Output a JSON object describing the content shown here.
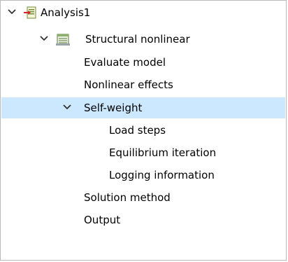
{
  "tree": {
    "analysis": {
      "label": "Analysis1",
      "icon": "analysis-document-icon",
      "expanded": true
    },
    "structural": {
      "label": "Structural nonlinear",
      "icon": "structural-nonlinear-icon",
      "expanded": true
    },
    "items": {
      "evaluate_model": "Evaluate model",
      "nonlinear_effects": "Nonlinear effects",
      "self_weight": "Self-weight",
      "load_steps": "Load steps",
      "equilibrium_iteration": "Equilibrium iteration",
      "logging_information": "Logging information",
      "solution_method": "Solution method",
      "output": "Output"
    },
    "selected": "Self-weight",
    "selection_color": "#cce8ff"
  }
}
